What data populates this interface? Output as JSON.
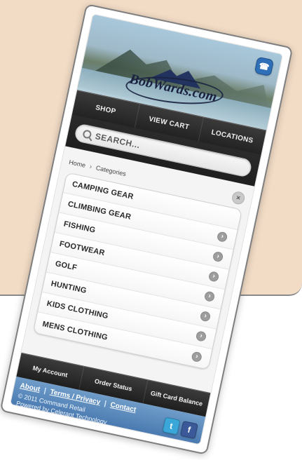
{
  "brand": {
    "logo_text": "BobWards.com"
  },
  "header": {
    "phone_icon": "phone-icon"
  },
  "nav": {
    "items": [
      {
        "label": "SHOP"
      },
      {
        "label": "VIEW CART"
      },
      {
        "label": "LOCATIONS"
      }
    ]
  },
  "search": {
    "placeholder": "SEARCH..."
  },
  "breadcrumb": {
    "home": "Home",
    "sep": "›",
    "current": "Categories"
  },
  "categories": [
    {
      "label": "CAMPING GEAR"
    },
    {
      "label": "CLIMBING GEAR"
    },
    {
      "label": "FISHING"
    },
    {
      "label": "FOOTWEAR"
    },
    {
      "label": "GOLF"
    },
    {
      "label": "HUNTING"
    },
    {
      "label": "KIDS CLOTHING"
    },
    {
      "label": "MENS CLOTHING"
    }
  ],
  "footer": {
    "tabs": [
      {
        "label": "My Account"
      },
      {
        "label": "Order Status"
      },
      {
        "label": "Gift Card Balance"
      }
    ],
    "links": [
      {
        "label": "About"
      },
      {
        "label": "Terms / Privacy"
      },
      {
        "label": "Contact"
      }
    ],
    "link_sep": "|",
    "copyright_line1": "© 2011 Command Retail",
    "copyright_line2": "Powered by Celerant Technology"
  },
  "social": {
    "twitter": "t",
    "facebook": "f"
  },
  "colors": {
    "page_bg": "#f2dcc6",
    "accent_blue": "#2e6fb7",
    "footer_blue": "#4a7ab1"
  }
}
